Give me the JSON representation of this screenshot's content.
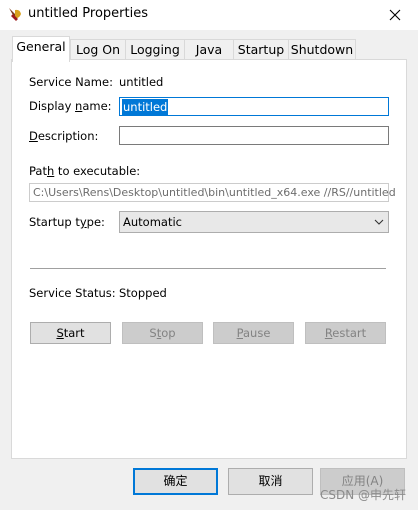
{
  "window": {
    "title": "untitled Properties"
  },
  "tabs": [
    {
      "label": "General"
    },
    {
      "label": "Log On"
    },
    {
      "label": "Logging"
    },
    {
      "label": "Java"
    },
    {
      "label": "Startup"
    },
    {
      "label": "Shutdown"
    }
  ],
  "general": {
    "service_name_label": "Service Name:",
    "service_name_value": "untitled",
    "display_name_label_pre": "Display ",
    "display_name_label_u": "n",
    "display_name_label_post": "ame:",
    "display_name_value": "untitled",
    "description_label_u": "D",
    "description_label_post": "escription:",
    "description_value": "",
    "path_label_pre": "Pat",
    "path_label_u": "h",
    "path_label_post": " to executable:",
    "path_value": "C:\\Users\\Rens\\Desktop\\untitled\\bin\\untitled_x64.exe //RS//untitled",
    "startup_type_label_pre": "Startup t",
    "startup_type_label_u": "y",
    "startup_type_label_post": "pe:",
    "startup_type_value": "Automatic",
    "service_status_label": "Service Status:",
    "service_status_value": "Stopped"
  },
  "service_buttons": {
    "start_u": "S",
    "start_post": "tart",
    "stop_pre": "S",
    "stop_u": "t",
    "stop_post": "op",
    "pause_u": "P",
    "pause_post": "ause",
    "restart_u": "R",
    "restart_post": "estart"
  },
  "footer": {
    "ok": "确定",
    "cancel": "取消",
    "apply": "应用(A)"
  },
  "watermark": "CSDN @申先轩",
  "colors": {
    "accent": "#0078d7",
    "panel_bg": "#ffffff",
    "window_bg": "#f0f0f0"
  }
}
